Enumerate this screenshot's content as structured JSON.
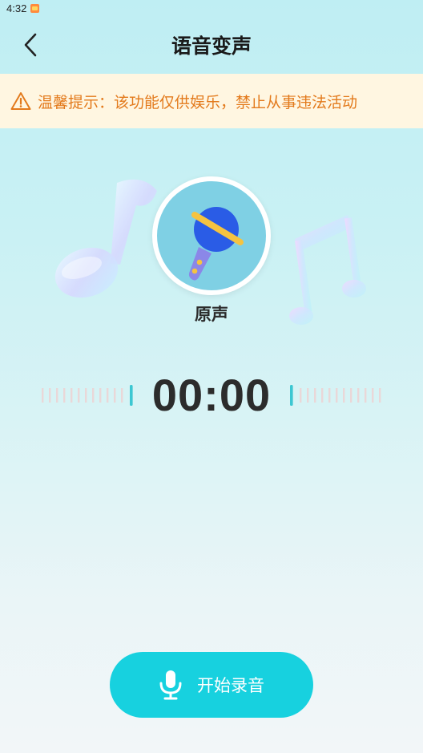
{
  "status_bar": {
    "time": "4:32"
  },
  "header": {
    "title": "语音变声"
  },
  "notice": {
    "text": "温馨提示：该功能仅供娱乐，禁止从事违法活动"
  },
  "voice": {
    "current_label": "原声"
  },
  "timer": {
    "value": "00:00"
  },
  "record_button": {
    "label": "开始录音"
  },
  "colors": {
    "accent": "#17d1df",
    "notice_text": "#e37a1c",
    "notice_bg": "#fff6e1",
    "waveform_active": "#3cc7d2"
  },
  "icons": {
    "back": "chevron-left-icon",
    "notice": "warning-icon",
    "avatar": "microphone-icon",
    "record": "microphone-icon"
  }
}
